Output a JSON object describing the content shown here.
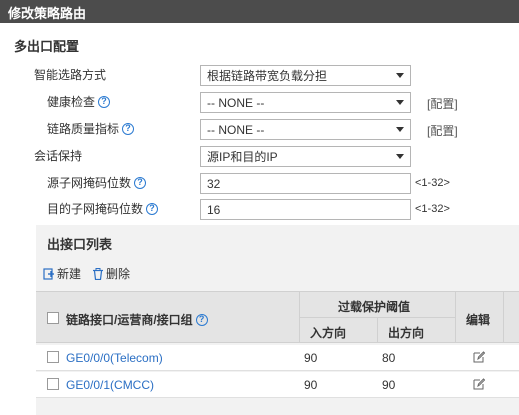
{
  "window": {
    "title": "修改策略路由"
  },
  "section": {
    "title": "多出口配置"
  },
  "form": {
    "smart_mode": {
      "label": "智能选路方式",
      "value": "根据链路带宽负载分担"
    },
    "health_check": {
      "label": "健康检查",
      "value": "-- NONE --",
      "config": "[配置]"
    },
    "link_quality": {
      "label": "链路质量指标",
      "value": "-- NONE --",
      "config": "[配置]"
    },
    "session_keep": {
      "label": "会话保持",
      "value": "源IP和目的IP"
    },
    "src_mask": {
      "label": "源子网掩码位数",
      "value": "32",
      "range": "<1-32>"
    },
    "dst_mask": {
      "label": "目的子网掩码位数",
      "value": "16",
      "range": "<1-32>"
    }
  },
  "list": {
    "title": "出接口列表",
    "toolbar": {
      "new_label": "新建",
      "delete_label": "删除"
    },
    "columns": {
      "interface": "链路接口/运营商/接口组",
      "overload_group": "过载保护阈值",
      "inbound": "入方向",
      "outbound": "出方向",
      "edit": "编辑"
    },
    "rows": [
      {
        "interface": "GE0/0/0(Telecom)",
        "inbound": "90",
        "outbound": "80"
      },
      {
        "interface": "GE0/0/1(CMCC)",
        "inbound": "90",
        "outbound": "90"
      }
    ]
  },
  "icons": {
    "help": "question-circle-icon",
    "new": "add-document-icon",
    "delete": "trash-icon",
    "edit": "edit-pencil-icon"
  },
  "colors": {
    "titlebar": "#4c4c4c",
    "link": "#2b6fc4",
    "help": "#2b7ad1"
  }
}
